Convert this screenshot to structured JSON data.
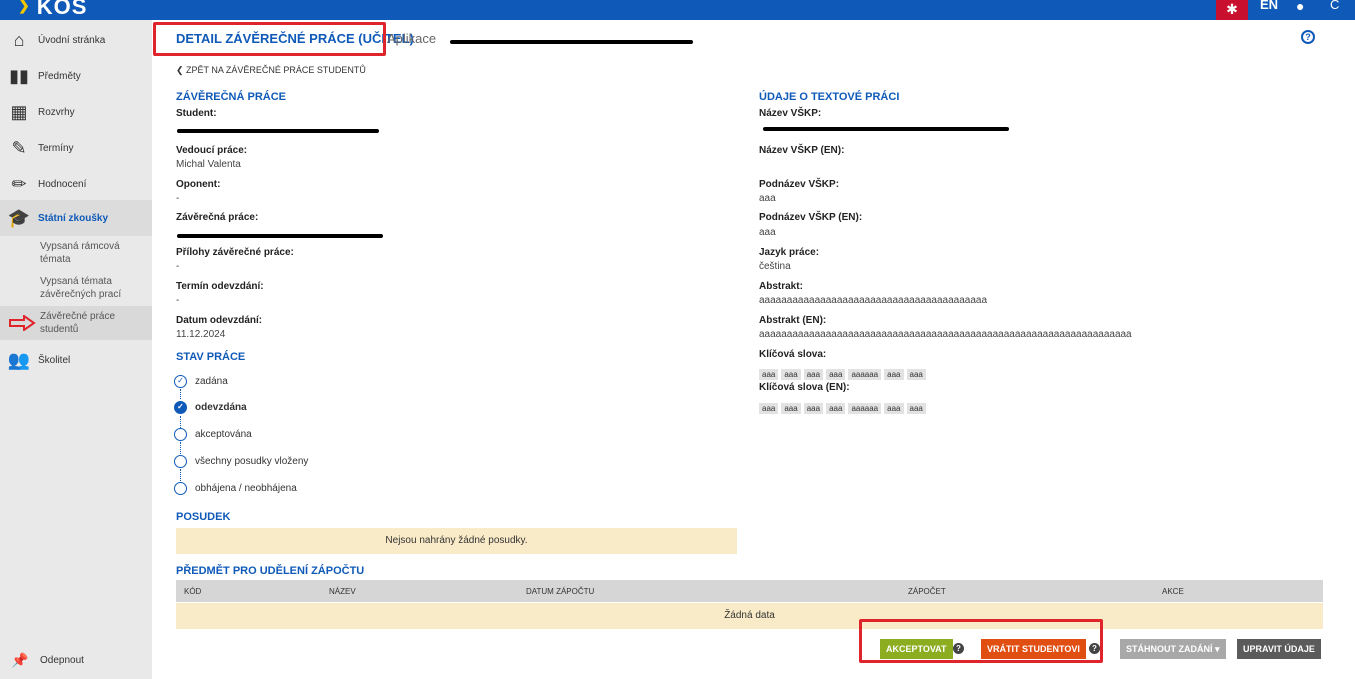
{
  "topbar": {
    "logo": "KOS",
    "lang": "EN"
  },
  "sidebar": {
    "items": [
      {
        "label": "Úvodní stránka",
        "icon": "home-icon"
      },
      {
        "label": "Předměty",
        "icon": "book-icon"
      },
      {
        "label": "Rozvrhy",
        "icon": "calendar-icon"
      },
      {
        "label": "Termíny",
        "icon": "edit-calendar-icon"
      },
      {
        "label": "Hodnocení",
        "icon": "pencil-icon"
      },
      {
        "label": "Státní zkoušky",
        "icon": "graduation-cap-icon"
      },
      {
        "label": "Školitel",
        "icon": "users-icon"
      }
    ],
    "subitems": [
      {
        "label": "Vypsaná rámcová témata"
      },
      {
        "label": "Vypsaná témata závěrečných prací"
      },
      {
        "label": "Závěrečné práce studentů"
      }
    ],
    "unpin": "Odepnout"
  },
  "header": {
    "title": "DETAIL ZÁVĚREČNÉ PRÁCE (UČITEL)",
    "app": "Aplikace"
  },
  "back_link": "ZPĚT NA ZÁVĚREČNÉ PRÁCE STUDENTŮ",
  "thesis": {
    "heading": "ZÁVĚREČNÁ PRÁCE",
    "student_label": "Student:",
    "supervisor_label": "Vedoucí práce:",
    "supervisor_value": "Michal Valenta",
    "opponent_label": "Oponent:",
    "opponent_value": "-",
    "thesis_label": "Závěrečná práce:",
    "attachments_label": "Přílohy závěrečné práce:",
    "attachments_value": "-",
    "deadline_label": "Termín odevzdání:",
    "deadline_value": "-",
    "submitted_label": "Datum odevzdání:",
    "submitted_value": "11.12.2024"
  },
  "status": {
    "heading": "STAV PRÁCE",
    "steps": [
      {
        "label": "zadána"
      },
      {
        "label": "odevzdána"
      },
      {
        "label": "akceptována"
      },
      {
        "label": "všechny posudky vloženy"
      },
      {
        "label": "obhájena / neobhájena"
      }
    ]
  },
  "review": {
    "heading": "POSUDEK",
    "empty": "Nejsou nahrány žádné posudky."
  },
  "text_info": {
    "heading": "ÚDAJE O TEXTOVÉ PRÁCI",
    "title_label": "Název VŠKP:",
    "title_en_label": "Název VŠKP (EN):",
    "subtitle_label": "Podnázev VŠKP:",
    "subtitle_value": "aaa",
    "subtitle_en_label": "Podnázev VŠKP (EN):",
    "subtitle_en_value": "aaa",
    "language_label": "Jazyk práce:",
    "language_value": "čeština",
    "abstract_label": "Abstrakt:",
    "abstract_value": "aaaaaaaaaaaaaaaaaaaaaaaaaaaaaaaaaaaaaaaaa",
    "abstract_en_label": "Abstrakt (EN):",
    "abstract_en_value": "aaaaaaaaaaaaaaaaaaaaaaaaaaaaaaaaaaaaaaaaaaaaaaaaaaaaaaaaaaaaaaaaaaa",
    "keywords_label": "Klíčová slova:",
    "keywords": [
      "aaa",
      "aaa",
      "aaa",
      "aaa",
      "aaaaaa",
      "aaa",
      "aaa"
    ],
    "keywords_en_label": "Klíčová slova (EN):",
    "keywords_en": [
      "aaa",
      "aaa",
      "aaa",
      "aaa",
      "aaaaaa",
      "aaa",
      "aaa"
    ]
  },
  "credit": {
    "heading": "PŘEDMĚT PRO UDĚLENÍ ZÁPOČTU",
    "columns": [
      "KÓD",
      "NÁZEV",
      "DATUM ZÁPOČTU",
      "ZÁPOČET",
      "AKCE"
    ],
    "empty": "Žádná data"
  },
  "actions": {
    "accept": "AKCEPTOVAT",
    "return": "VRÁTIT STUDENTOVI",
    "download": "STÁHNOUT ZADÁNÍ",
    "edit": "UPRAVIT ÚDAJE"
  }
}
